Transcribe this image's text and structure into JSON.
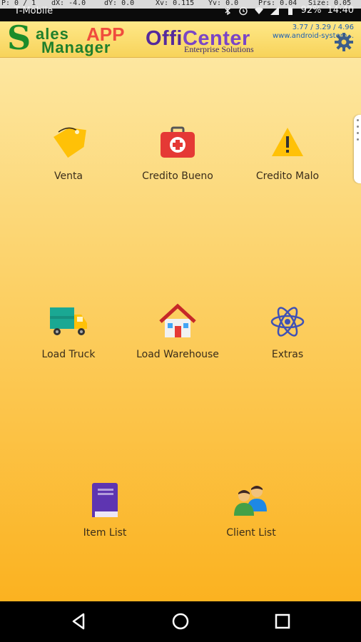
{
  "status_bar": {
    "debug": {
      "p": "P: 0 / 1",
      "dx": "dX: -4.0",
      "dy": "dY: 0.0",
      "xv": "Xv: 0.115",
      "yv": "Yv: 0.0",
      "prs": "Prs: 0.04",
      "size": "Size: 0.05"
    },
    "carrier": "T-Mobile",
    "battery": "92%",
    "time": "14:40",
    "icons": [
      "bluetooth-icon",
      "alarm-icon",
      "wifi-icon",
      "signal-icon",
      "battery-icon"
    ]
  },
  "header": {
    "logo_big_letter": "S",
    "logo_line1": "ales",
    "logo_app": "APP",
    "logo_line2": "Manager",
    "brand_offi": "Offi",
    "brand_center": "Center",
    "tagline": "Enterprise Solutions",
    "version_line1": "3.77 / 3.29 / 4.96",
    "version_line2": "www.android-system...",
    "settings_icon": "gear-icon"
  },
  "menu": {
    "row1": [
      {
        "label": "Venta",
        "icon": "tag-icon"
      },
      {
        "label": "Credito Bueno",
        "icon": "first-aid-kit-icon"
      },
      {
        "label": "Credito Malo",
        "icon": "warning-icon"
      }
    ],
    "row2": [
      {
        "label": "Load Truck",
        "icon": "truck-icon"
      },
      {
        "label": "Load Warehouse",
        "icon": "house-icon"
      },
      {
        "label": "Extras",
        "icon": "atom-icon"
      }
    ],
    "row3": [
      {
        "label": "Item List",
        "icon": "book-icon"
      },
      {
        "label": "Client List",
        "icon": "users-icon"
      }
    ]
  },
  "colors": {
    "header_bg": "#f7d35a",
    "main_top": "#fde7a0",
    "main_bottom": "#fbb220",
    "label_text": "#3a2d1a"
  },
  "navbar": {
    "icons": [
      "back-icon",
      "home-icon",
      "recents-icon"
    ]
  }
}
